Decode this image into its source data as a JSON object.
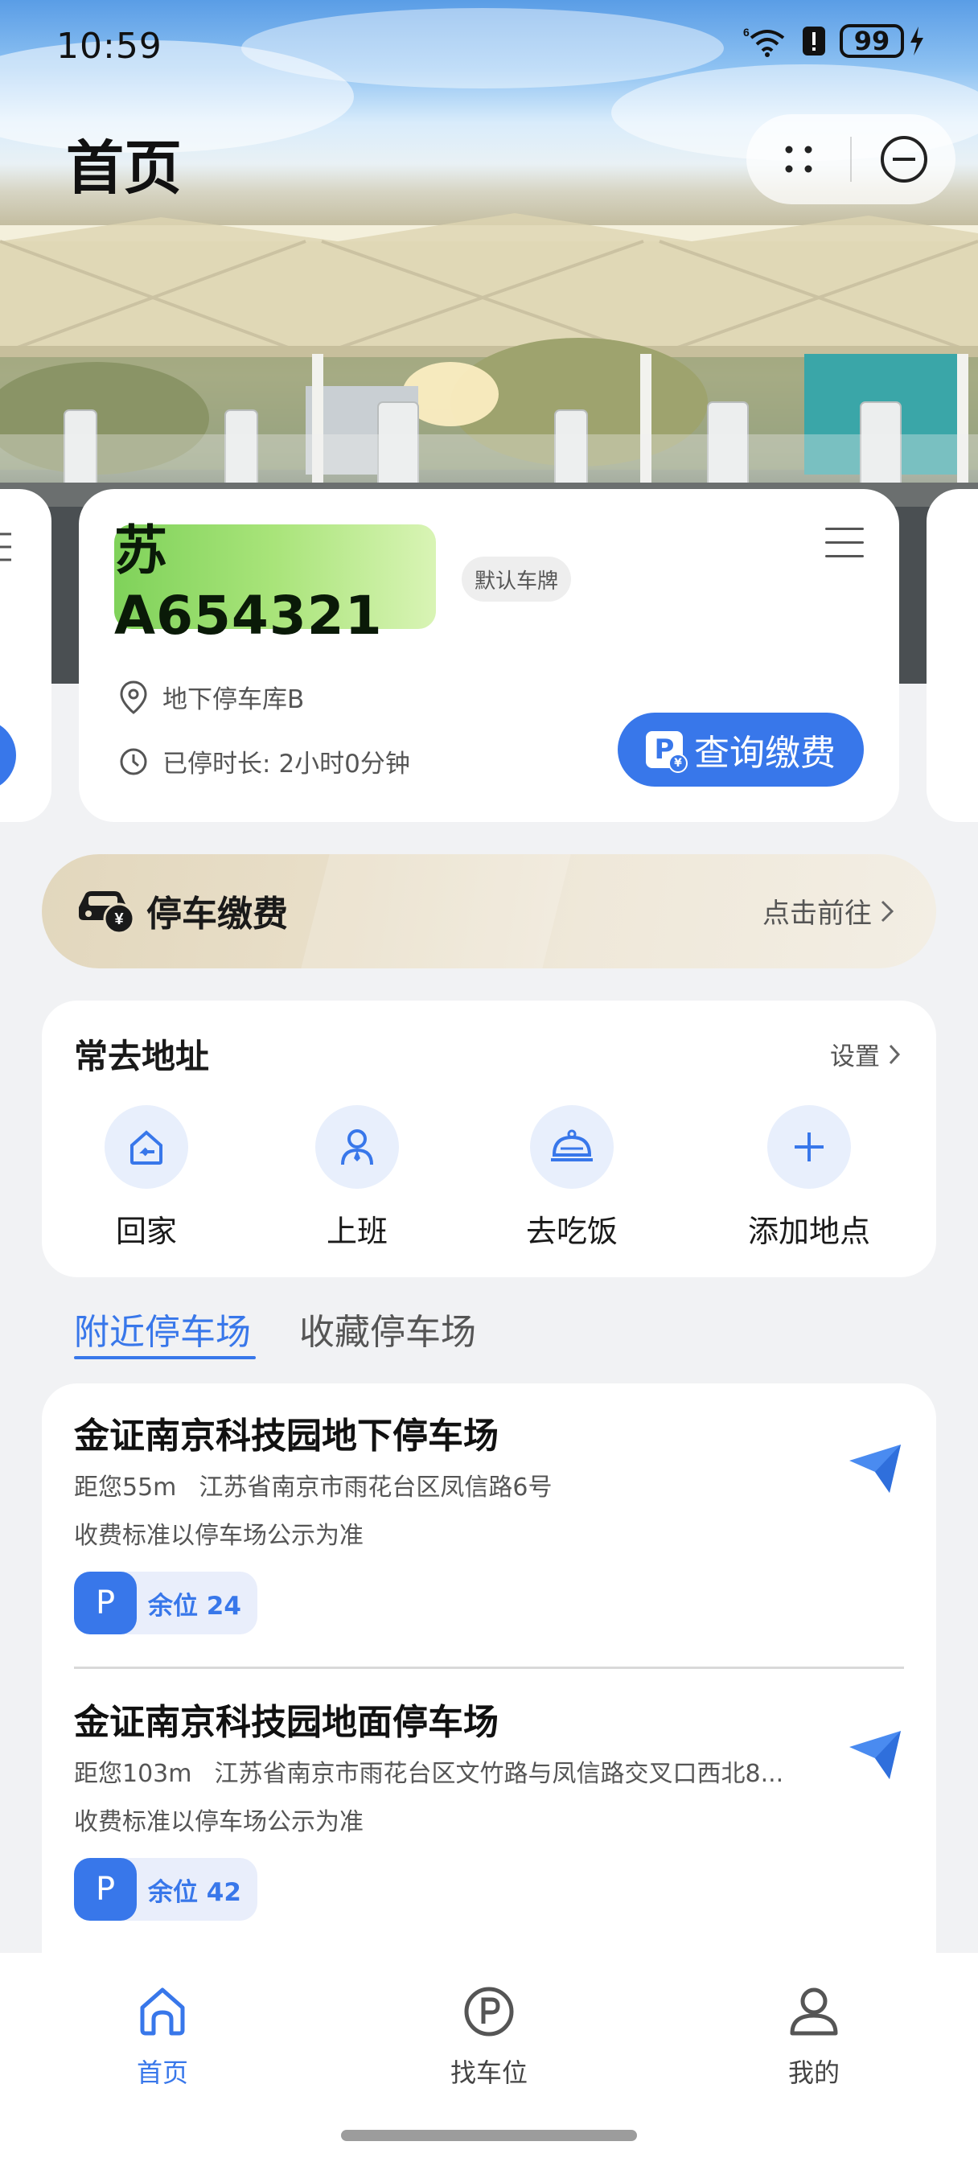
{
  "status_bar": {
    "time": "10:59",
    "signal_label": "6",
    "battery": "99"
  },
  "header": {
    "title": "首页"
  },
  "vehicle_card": {
    "plate": "苏A654321",
    "default_tag": "默认车牌",
    "location": "地下停车库B",
    "duration_label": "已停时长:",
    "duration_value": "2小时0分钟",
    "query_pay_label": "查询缴费"
  },
  "payment_banner": {
    "label": "停车缴费",
    "action": "点击前往"
  },
  "frequent_addresses": {
    "title": "常去地址",
    "settings": "设置",
    "items": [
      {
        "label": "回家",
        "icon": "home-return-icon"
      },
      {
        "label": "上班",
        "icon": "worker-icon"
      },
      {
        "label": "去吃饭",
        "icon": "dining-cloche-icon"
      },
      {
        "label": "添加地点",
        "icon": "plus-icon"
      }
    ]
  },
  "tabs": [
    {
      "label": "附近停车场",
      "active": true
    },
    {
      "label": "收藏停车场",
      "active": false
    }
  ],
  "parking_lots": [
    {
      "name": "金证南京科技园地下停车场",
      "distance": "距您55m",
      "address": "江苏省南京市雨花台区凤信路6号",
      "fee_note": "收费标准以停车场公示为准",
      "p_label": "P",
      "spots": "余位 24"
    },
    {
      "name": "金证南京科技园地面停车场",
      "distance": "距您103m",
      "address": "江苏省南京市雨花台区文竹路与凤信路交叉口西北8...",
      "fee_note": "收费标准以停车场公示为准",
      "p_label": "P",
      "spots": "余位 42"
    }
  ],
  "bottom_nav": [
    {
      "label": "首页",
      "icon": "home-icon",
      "active": true
    },
    {
      "label": "找车位",
      "icon": "parking-icon",
      "active": false
    },
    {
      "label": "我的",
      "icon": "person-icon",
      "active": false
    }
  ],
  "colors": {
    "primary": "#3877ea",
    "plate_green": "#8fd966",
    "background": "#f1f2f4"
  }
}
